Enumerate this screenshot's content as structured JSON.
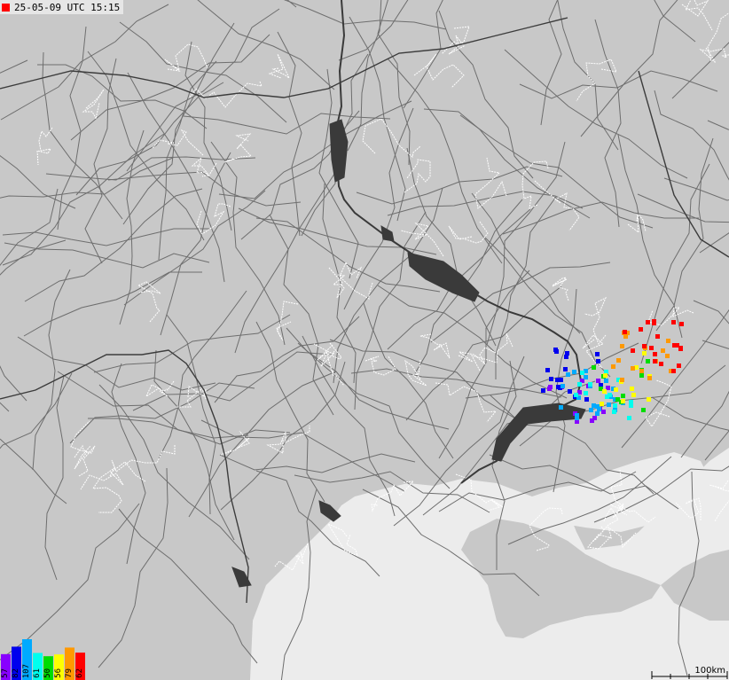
{
  "timestamp": "25-05-09 UTC 15:15",
  "timestamp_marker_color": "#ff0000",
  "colors": {
    "land": "#c8c8c8",
    "sea": "#ececec",
    "water": "#3a3a3a",
    "roads": "#6e6e6e",
    "borders_admin": "#ffffff",
    "borders_country": "#3c3c3c"
  },
  "legend": [
    {
      "label": "57",
      "color": "#8800ff",
      "count": 57
    },
    {
      "label": "82",
      "color": "#0000ee",
      "count": 82
    },
    {
      "label": "107",
      "color": "#00aaff",
      "count": 107
    },
    {
      "label": "61",
      "color": "#00ffee",
      "count": 61
    },
    {
      "label": "50",
      "color": "#00dd00",
      "count": 50
    },
    {
      "label": "56",
      "color": "#ffff00",
      "count": 56
    },
    {
      "label": "79",
      "color": "#ff9900",
      "count": 79
    },
    {
      "label": "62",
      "color": "#ff0000",
      "count": 62
    }
  ],
  "scale": {
    "label": "100km"
  },
  "strike_clusters": [
    {
      "color": "#8800ff",
      "count": 14
    },
    {
      "color": "#0000ee",
      "count": 18
    },
    {
      "color": "#00aaff",
      "count": 22
    },
    {
      "color": "#00ffee",
      "count": 14
    },
    {
      "color": "#00dd00",
      "count": 10
    },
    {
      "color": "#ffff00",
      "count": 12
    },
    {
      "color": "#ff9900",
      "count": 16
    },
    {
      "color": "#ff0000",
      "count": 20
    }
  ]
}
